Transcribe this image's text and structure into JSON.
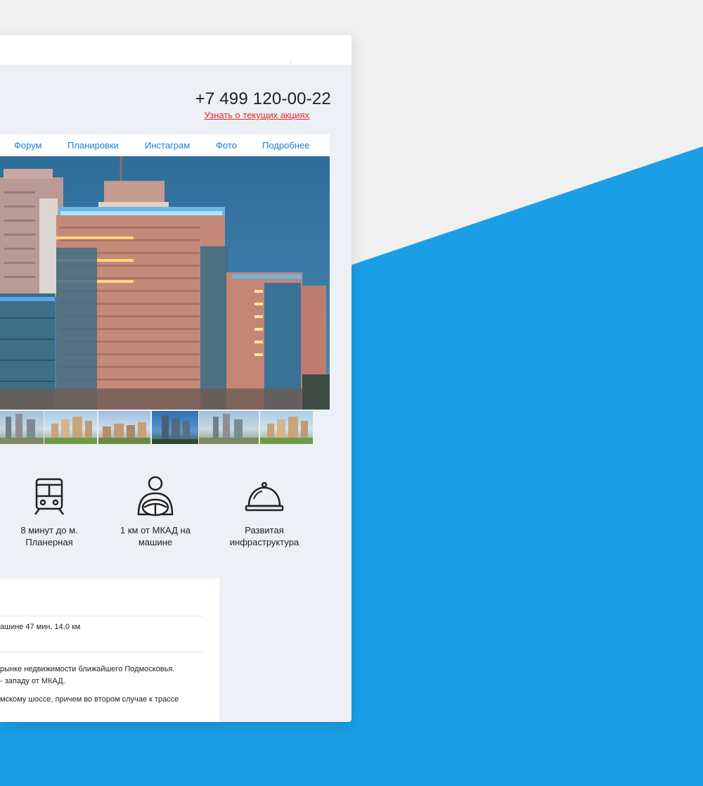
{
  "header": {
    "phone": "+7 499 120-00-22",
    "promo_link": "Узнать о текущих акциях"
  },
  "nav": {
    "items": [
      {
        "label": "Форум"
      },
      {
        "label": "Планировки"
      },
      {
        "label": "Инстаграм"
      },
      {
        "label": "Фото"
      },
      {
        "label": "Подробнее"
      }
    ]
  },
  "features": [
    {
      "icon": "train-icon",
      "text": "8 минут до м. Планерная"
    },
    {
      "icon": "driver-icon",
      "text": "1 км от МКАД на машине"
    },
    {
      "icon": "cloche-icon",
      "text": "Развитая инфраструктура"
    }
  ],
  "info": {
    "route": "ашине 47 мин, 14,0 км",
    "para1_line1": "рынке недвижимости ближайшего Подмосковья.",
    "para1_line2": "- западу от МКАД.",
    "para2_line1": "мскому шоссе, причем во втором случае к трассе"
  },
  "colors": {
    "accent_blue": "#1a9fe6",
    "link_blue": "#1a7fd0",
    "promo_red": "#e0282d",
    "card_bg": "#edf0f4"
  }
}
